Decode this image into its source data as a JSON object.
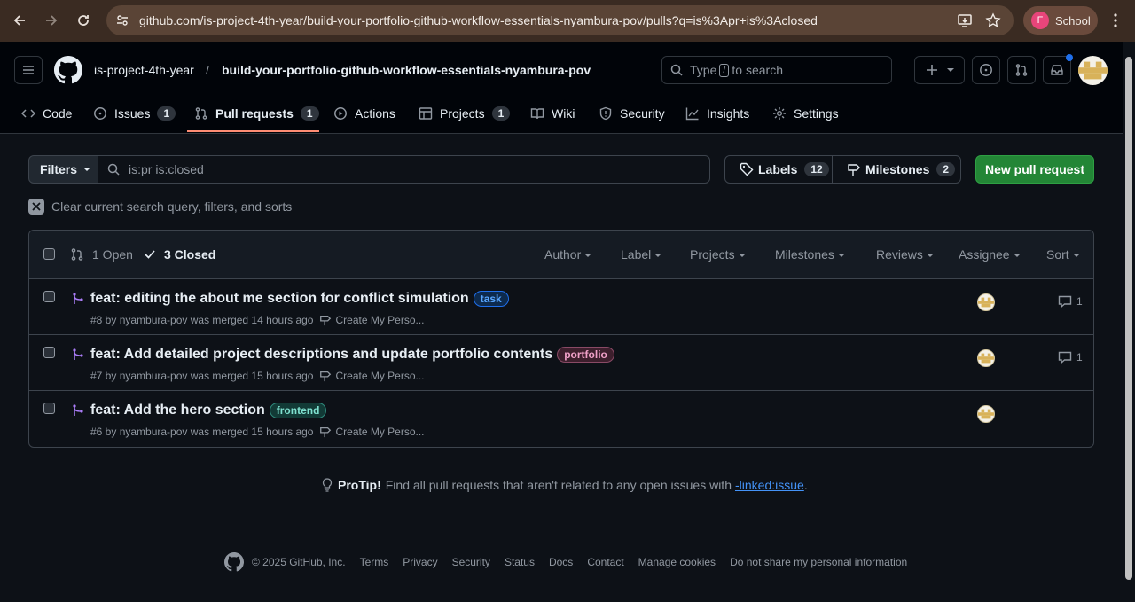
{
  "browser": {
    "url": "github.com/is-project-4th-year/build-your-portfolio-github-workflow-essentials-nyambura-pov/pulls?q=is%3Apr+is%3Aclosed",
    "profile_initial": "F",
    "profile_label": "School"
  },
  "header": {
    "owner": "is-project-4th-year",
    "separator": "/",
    "repo": "build-your-portfolio-github-workflow-essentials-nyambura-pov",
    "search_prefix": "Type",
    "search_key": "/",
    "search_suffix": "to search"
  },
  "tabs": [
    {
      "label": "Code",
      "count": ""
    },
    {
      "label": "Issues",
      "count": "1"
    },
    {
      "label": "Pull requests",
      "count": "1"
    },
    {
      "label": "Actions",
      "count": ""
    },
    {
      "label": "Projects",
      "count": "1"
    },
    {
      "label": "Wiki",
      "count": ""
    },
    {
      "label": "Security",
      "count": ""
    },
    {
      "label": "Insights",
      "count": ""
    },
    {
      "label": "Settings",
      "count": ""
    }
  ],
  "toolbar": {
    "filters_label": "Filters",
    "query": "is:pr is:closed",
    "labels_label": "Labels",
    "labels_count": "12",
    "milestones_label": "Milestones",
    "milestones_count": "2",
    "new_pr_label": "New pull request",
    "clear_label": "Clear current search query, filters, and sorts"
  },
  "list": {
    "open_label": "1 Open",
    "closed_label": "3 Closed",
    "filters": [
      "Author",
      "Label",
      "Projects",
      "Milestones",
      "Reviews",
      "Assignee",
      "Sort"
    ],
    "rows": [
      {
        "title": "feat: editing the about me section for conflict simulation",
        "label": "task",
        "label_color": "#1f6feb",
        "meta": "#8 by nyambura-pov was merged 14 hours ago",
        "milestone": "Create My Perso...",
        "comments": "1"
      },
      {
        "title": "feat: Add detailed project descriptions and update portfolio contents",
        "label": "portfolio",
        "label_color": "#d2a8ff",
        "meta": "#7 by nyambura-pov was merged 15 hours ago",
        "milestone": "Create My Perso...",
        "comments": "1"
      },
      {
        "title": "feat: Add the hero section",
        "label": "frontend",
        "label_color": "#3fb9a7",
        "meta": "#6 by nyambura-pov was merged 15 hours ago",
        "milestone": "Create My Perso...",
        "comments": ""
      }
    ]
  },
  "protip": {
    "bold": "ProTip!",
    "text": "Find all pull requests that aren't related to any open issues with",
    "link": "-linked:issue",
    "end": "."
  },
  "footer": {
    "copyright": "© 2025 GitHub, Inc.",
    "links": [
      "Terms",
      "Privacy",
      "Security",
      "Status",
      "Docs",
      "Contact",
      "Manage cookies",
      "Do not share my personal information"
    ]
  }
}
